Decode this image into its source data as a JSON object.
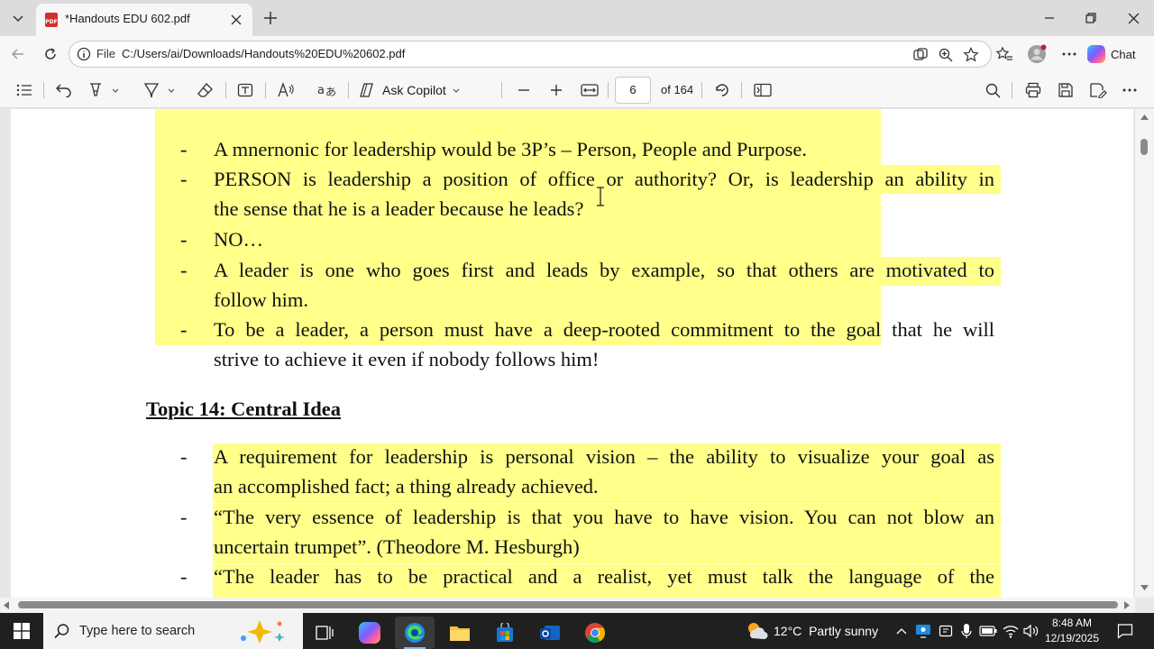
{
  "tab": {
    "title": "*Handouts EDU 602.pdf",
    "favicon_label": "PDF"
  },
  "address": {
    "scheme_label": "File",
    "url": "C:/Users/ai/Downloads/Handouts%20EDU%20602.pdf"
  },
  "chat": {
    "label": "Chat"
  },
  "pdf_toolbar": {
    "ask_copilot_label": "Ask Copilot",
    "page_number": "6",
    "page_total": "of 164"
  },
  "document": {
    "lines": [
      "A mnernonic for leadership would be 3P’s – Person, People and Purpose.",
      "PERSON is leadership a position of office or authority? Or, is leadership an ability in",
      "the sense that he is a leader because he leads?",
      "NO…",
      "A leader is one who goes first and leads by example, so that others are motivated to",
      "follow him.",
      "To be a leader,  a person must have a deep-rooted commitment to the goal that he will",
      "strive to achieve it even if nobody follows him!"
    ],
    "topic_heading": "Topic 14: Central Idea",
    "topic_lines": [
      "A requirement for leadership is personal vision – the ability to visualize your goal as",
      "an accomplished fact; a thing already achieved.",
      "“The very essence of leadership is that you have to have vision. You can not blow an",
      "uncertain trumpet”. (Theodore M. Hesburgh)",
      "“The leader has to be practical and a realist, yet must talk the language of the"
    ],
    "bullet": "-",
    "highlight_color": "#ffff8a"
  },
  "taskbar": {
    "search_placeholder": "Type here to search",
    "weather_temp": "12°C",
    "weather_desc": "Partly sunny",
    "time": "8:48 AM",
    "date": "12/19/2025"
  }
}
